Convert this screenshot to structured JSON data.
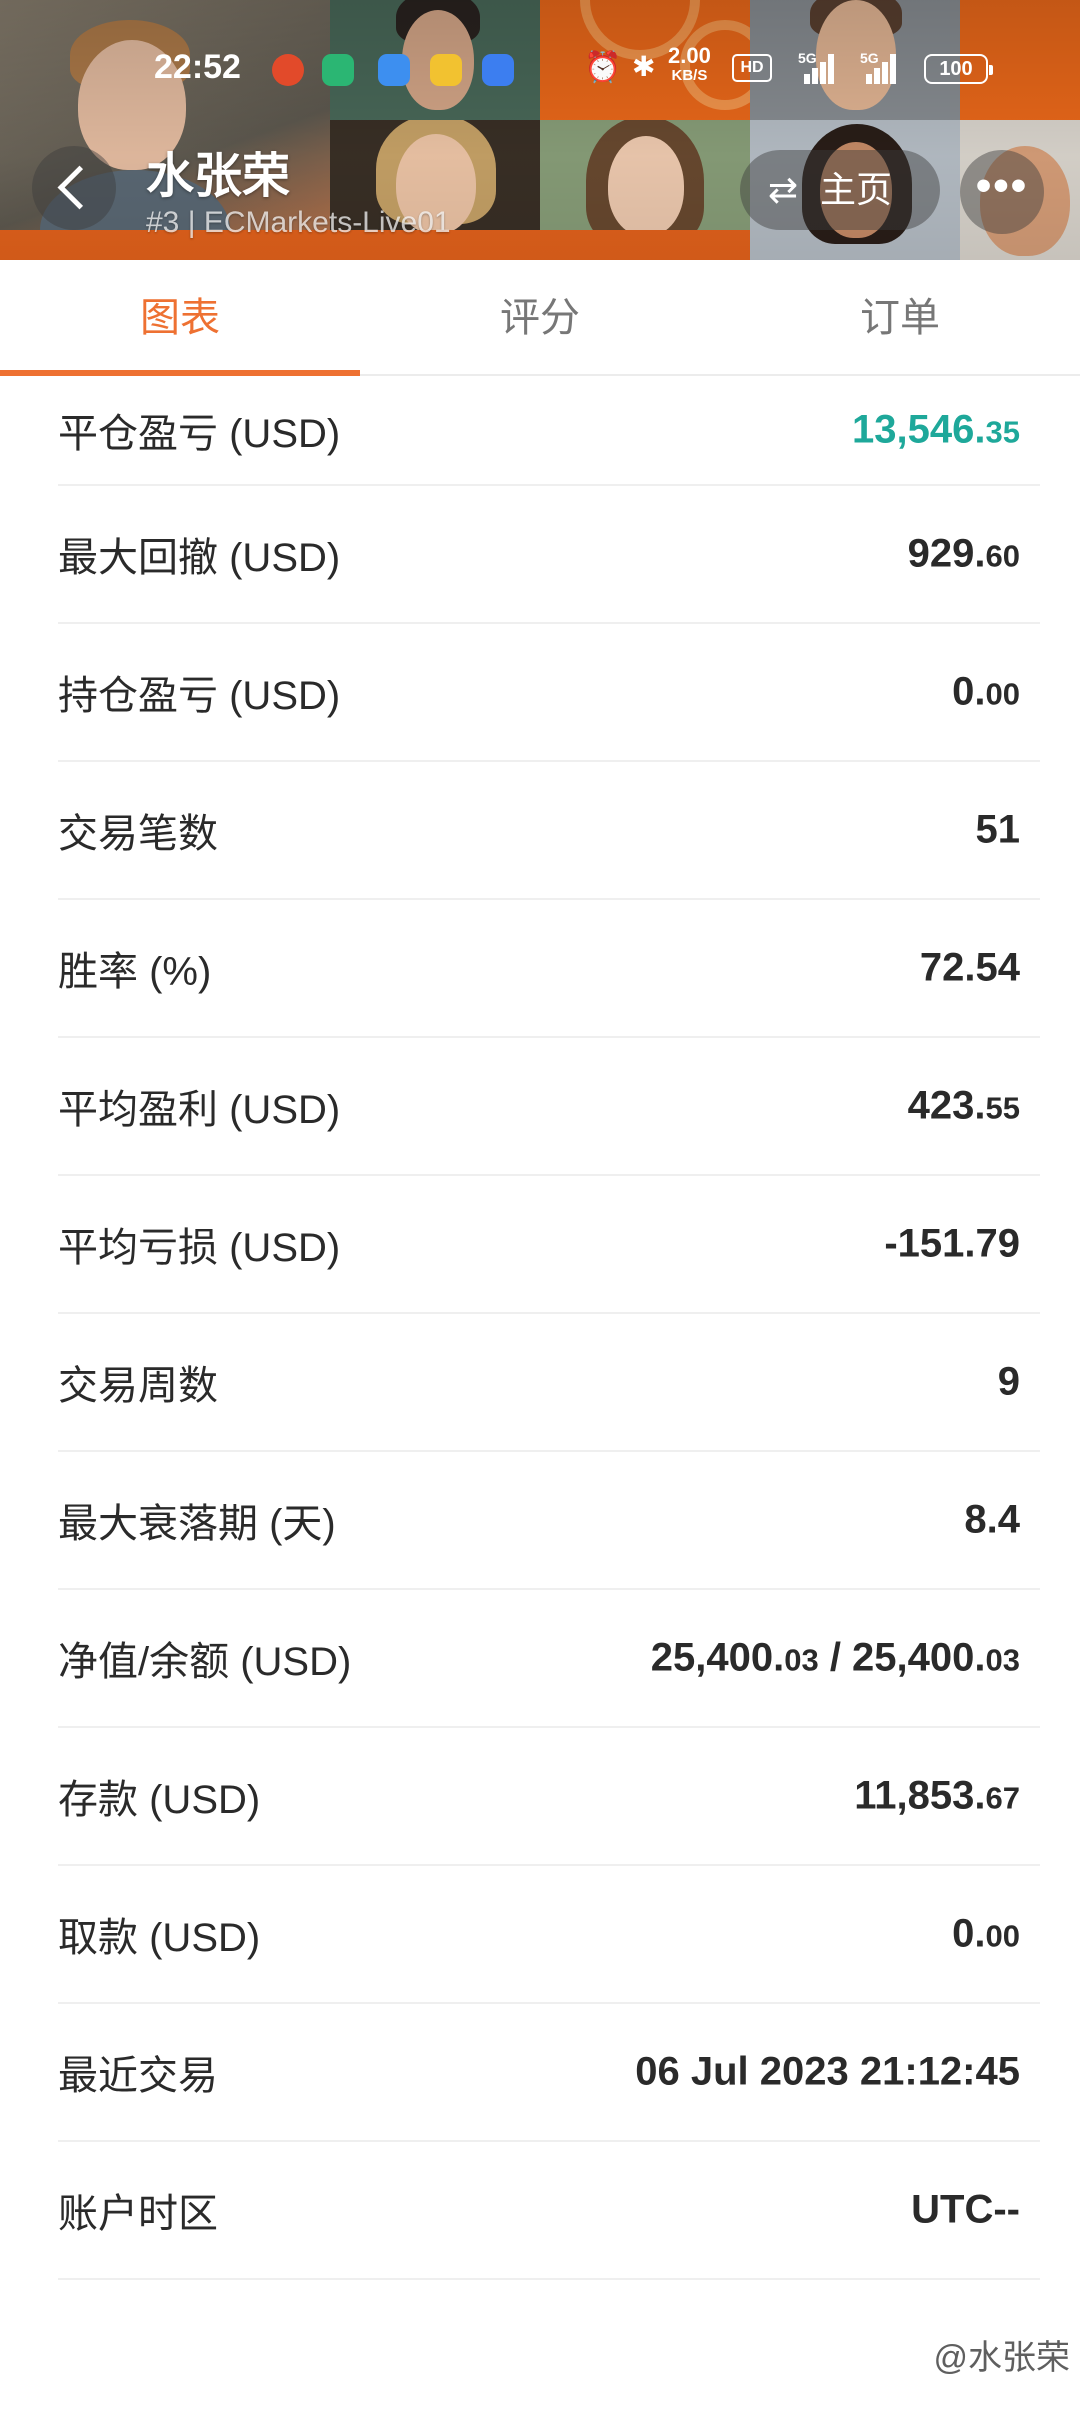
{
  "status_bar": {
    "time": "22:52",
    "net_speed": "2.00",
    "net_unit": "KB/S",
    "hd_label": "HD",
    "sim1": "5G",
    "sim2": "5G",
    "battery": "100"
  },
  "header": {
    "title": "水张荣",
    "subtitle": "#3 | ECMarkets-Live01",
    "home_label": "主页",
    "more_label": "•••"
  },
  "tabs": [
    {
      "label": "图表",
      "active": true
    },
    {
      "label": "评分",
      "active": false
    },
    {
      "label": "订单",
      "active": false
    }
  ],
  "rows": [
    {
      "label": "平仓盈亏 (USD)",
      "int": "13,546.",
      "dec": "35"
    },
    {
      "label": "最大回撤 (USD)",
      "int": "929.",
      "dec": "60"
    },
    {
      "label": "持仓盈亏 (USD)",
      "int": "0.",
      "dec": "00"
    },
    {
      "label": "交易笔数",
      "int": "51",
      "dec": ""
    },
    {
      "label": "胜率 (%)",
      "int": "72.54",
      "dec": ""
    },
    {
      "label": "平均盈利 (USD)",
      "int": "423.",
      "dec": "55"
    },
    {
      "label": "平均亏损 (USD)",
      "int": "-151.79",
      "dec": ""
    },
    {
      "label": "交易周数",
      "int": "9",
      "dec": ""
    },
    {
      "label": "最大衰落期 (天)",
      "int": "8.4",
      "dec": ""
    },
    {
      "label": "净值/余额 (USD)",
      "int": "25,400.",
      "dec": "03",
      "int2": " / 25,400.",
      "dec2": "03"
    },
    {
      "label": "存款 (USD)",
      "int": "11,853.",
      "dec": "67"
    },
    {
      "label": "取款 (USD)",
      "int": "0.",
      "dec": "00"
    },
    {
      "label": "最近交易",
      "int": "06 Jul 2023 21:12:45",
      "dec": ""
    },
    {
      "label": "账户时区",
      "int": "UTC--",
      "dec": ""
    }
  ],
  "watermark": "@水张荣",
  "colors": {
    "accent": "#ee7132",
    "positive": "#1ea89a",
    "header_orange": "#e8641c"
  }
}
